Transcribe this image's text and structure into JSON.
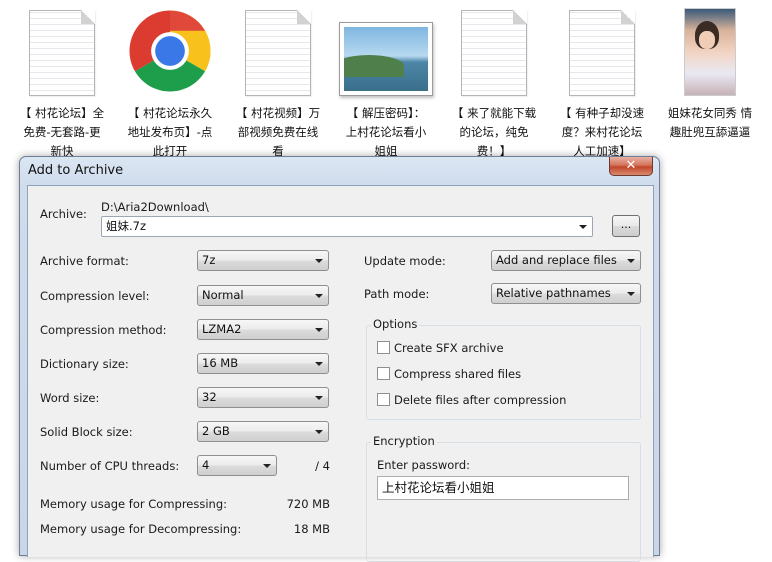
{
  "desktop": {
    "files": [
      {
        "label_lines": [
          "【 村花论坛】全",
          "免费-无套路-更",
          "新快"
        ],
        "icon": "text-document-icon"
      },
      {
        "label_lines": [
          "【 村花论坛永久",
          "地址发布页】-点",
          "此打开"
        ],
        "icon": "chrome-icon"
      },
      {
        "label_lines": [
          "【 村花视频】万",
          "部视频免费在线",
          "看"
        ],
        "icon": "text-document-icon"
      },
      {
        "label_lines": [
          "【 解压密码】：",
          "上村花论坛看小",
          "姐姐"
        ],
        "icon": "image-thumbnail-icon"
      },
      {
        "label_lines": [
          "【 来了就能下载",
          "的论坛，纯免",
          "费！】"
        ],
        "icon": "text-document-icon"
      },
      {
        "label_lines": [
          "【 有种子却没速",
          "度？来村花论坛",
          "人工加速】"
        ],
        "icon": "text-document-icon"
      },
      {
        "label_lines": [
          "姐妹花女同秀 情",
          "趣肚兜互舔逼逼"
        ],
        "icon": "video-thumbnail-icon"
      }
    ]
  },
  "dialog": {
    "title": "Add to Archive",
    "close_label": "✕",
    "archive_label": "Archive:",
    "archive_dir": "D:\\Aria2Download\\",
    "archive_name": "姐妹.7z",
    "browse_label": "...",
    "archive_format_label": "Archive format:",
    "archive_format_value": "7z",
    "compression_level_label": "Compression level:",
    "compression_level_value": "Normal",
    "compression_method_label": "Compression method:",
    "compression_method_value": "LZMA2",
    "dictionary_size_label": "Dictionary size:",
    "dictionary_size_value": "16 MB",
    "word_size_label": "Word size:",
    "word_size_value": "32",
    "solid_block_label": "Solid Block size:",
    "solid_block_value": "2 GB",
    "cpu_threads_label": "Number of CPU threads:",
    "cpu_threads_value": "4",
    "cpu_threads_max": "/ 4",
    "mem_compress_label": "Memory usage for Compressing:",
    "mem_compress_value": "720 MB",
    "mem_decompress_label": "Memory usage for Decompressing:",
    "mem_decompress_value": "18 MB",
    "update_mode_label": "Update mode:",
    "update_mode_value": "Add and replace files",
    "path_mode_label": "Path mode:",
    "path_mode_value": "Relative pathnames",
    "options_title": "Options",
    "opt_sfx": "Create SFX archive",
    "opt_shared": "Compress shared files",
    "opt_delete": "Delete files after compression",
    "encryption_title": "Encryption",
    "enter_password_label": "Enter password:",
    "password_value": "上村花论坛看小姐姐"
  }
}
